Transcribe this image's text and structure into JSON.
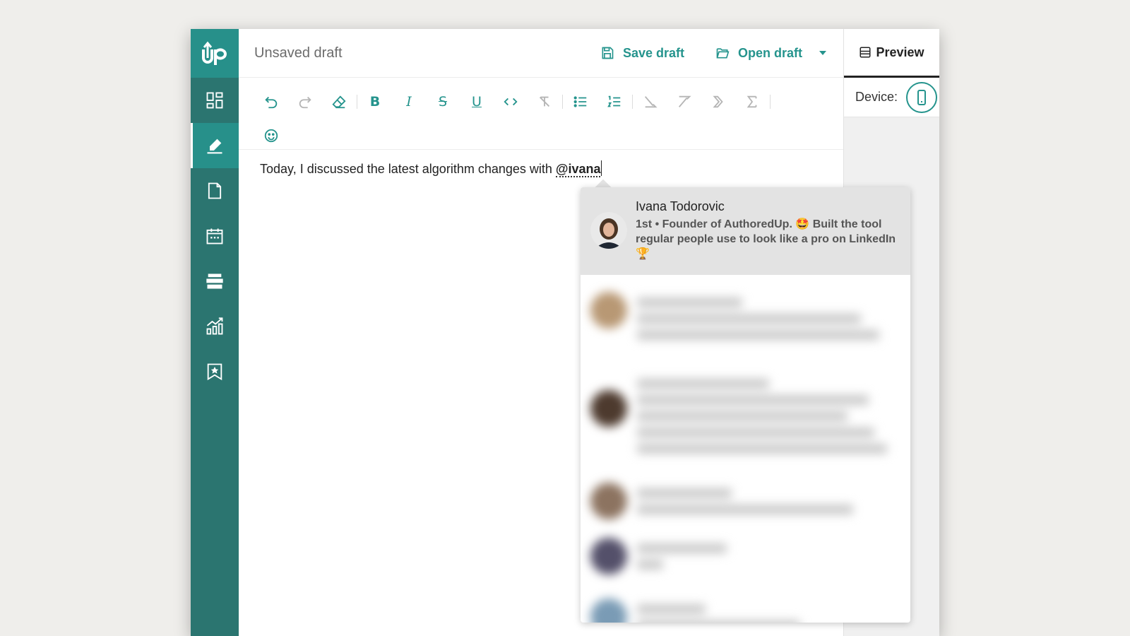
{
  "app": {
    "logo_text": "Up"
  },
  "sidebar": {
    "items": [
      {
        "name": "dashboard-icon",
        "active": false
      },
      {
        "name": "edit-pen-icon",
        "active": true
      },
      {
        "name": "document-icon",
        "active": false
      },
      {
        "name": "calendar-icon",
        "active": false
      },
      {
        "name": "archive-icon",
        "active": false
      },
      {
        "name": "analytics-icon",
        "active": false
      },
      {
        "name": "bookmark-star-icon",
        "active": false
      }
    ]
  },
  "header": {
    "title": "Unsaved draft",
    "save_label": "Save draft",
    "open_label": "Open draft"
  },
  "toolbar": {
    "bold": "B",
    "italic": "I",
    "strike": "S",
    "underline": "U"
  },
  "editor": {
    "text_before": "Today, I discussed the latest algorithm changes with ",
    "mention": "@ivana"
  },
  "preview": {
    "tab_label": "Preview",
    "device_label": "Device:"
  },
  "mention_dropdown": {
    "highlighted": {
      "name": "Ivana Todorovic",
      "description": "1st • Founder of AuthoredUp. 🤩 Built the tool regular people use to look like a pro on LinkedIn 🏆"
    }
  },
  "colors": {
    "accent": "#25948d",
    "sidebar": "#2b7570",
    "sidebar_active": "#27908a"
  }
}
